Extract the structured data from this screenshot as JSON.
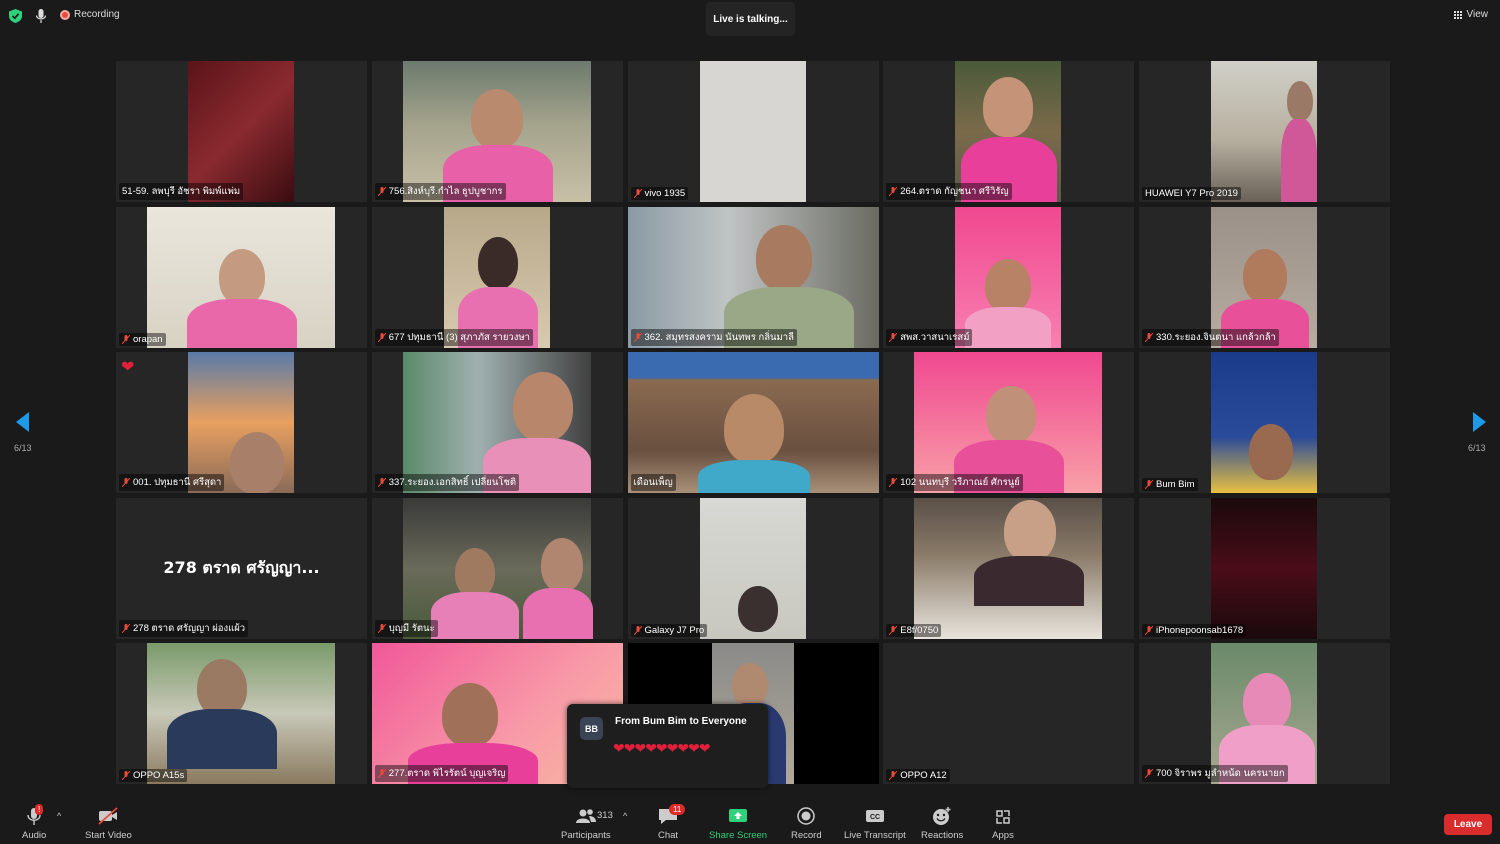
{
  "topbar": {
    "recording_label": "Recording",
    "talking_label": "Live is talking...",
    "view_label": "View"
  },
  "pagination": {
    "left_label": "6/13",
    "right_label": "6/13"
  },
  "tiles": [
    {
      "name": "51-59. ลพบุรี อัชรา พิมพ์แพ่ม",
      "muted": false
    },
    {
      "name": "756.สิงห์บุรี.กำไล ธูปบูชากร",
      "muted": true
    },
    {
      "name": "vivo 1935",
      "muted": true
    },
    {
      "name": "264.ตราด กัญชนา ศรีวิรัญ",
      "muted": true
    },
    {
      "name": "HUAWEI Y7 Pro 2019",
      "muted": false
    },
    {
      "name": "orapan",
      "muted": true
    },
    {
      "name": "677 ปทุมธานี (3) สุภาภัส รายวงษา",
      "muted": true
    },
    {
      "name": "362. สมุทรสงคราม นันทพร กลิ่นมาลี",
      "muted": true
    },
    {
      "name": "สพส.วาสนาเรสม์",
      "muted": true
    },
    {
      "name": "330.ระยอง.จินตนา แกล้วกล้า",
      "muted": true
    },
    {
      "name": "001. ปทุมธานี ศรีสุดา",
      "muted": true,
      "reaction": "❤"
    },
    {
      "name": "337.ระยอง.เอกสิทธิ์ เปลี่ยนโชติ",
      "muted": true
    },
    {
      "name": "เดือนเพ็ญ",
      "muted": false
    },
    {
      "name": "102 นนทบุรี วรีภาณย์ ศักรนูย์",
      "muted": true
    },
    {
      "name": "Bum Bim",
      "muted": true
    },
    {
      "name": "278 ตราด ศรัญญา ผ่องแผ้ว",
      "muted": true,
      "big_name": "278 ตราด ศรัญญา..."
    },
    {
      "name": "บุญมี รัตนะ",
      "muted": true
    },
    {
      "name": "Galaxy J7 Pro",
      "muted": true
    },
    {
      "name": "E8f/0750",
      "muted": true
    },
    {
      "name": "iPhonepoonsab1678",
      "muted": true
    },
    {
      "name": "OPPO A15s",
      "muted": true
    },
    {
      "name": "277.ตราด พิไรรัตน์ บุญเจริญ",
      "muted": true
    },
    {
      "name": "",
      "muted": false
    },
    {
      "name": "OPPO A12",
      "muted": true
    },
    {
      "name": "700 จิราพร มูลำหน้ด นครนายก",
      "muted": true
    }
  ],
  "chat_popup": {
    "avatar": "BB",
    "from": "From Bum Bim to Everyone",
    "message": "❤❤❤❤❤❤❤❤❤"
  },
  "toolbar": {
    "audio_label": "Audio",
    "video_label": "Start Video",
    "participants_label": "Participants",
    "participants_count": "313",
    "chat_label": "Chat",
    "chat_badge": "11",
    "share_label": "Share Screen",
    "record_label": "Record",
    "transcript_label": "Live Transcript",
    "reactions_label": "Reactions",
    "apps_label": "Apps",
    "leave_label": "Leave",
    "audio_badge": "!"
  },
  "colors": {
    "accent_green": "#2fd17a",
    "leave_red": "#d92c2c",
    "pink_shirt": "#e860a8",
    "heart_red": "#e0203a"
  }
}
